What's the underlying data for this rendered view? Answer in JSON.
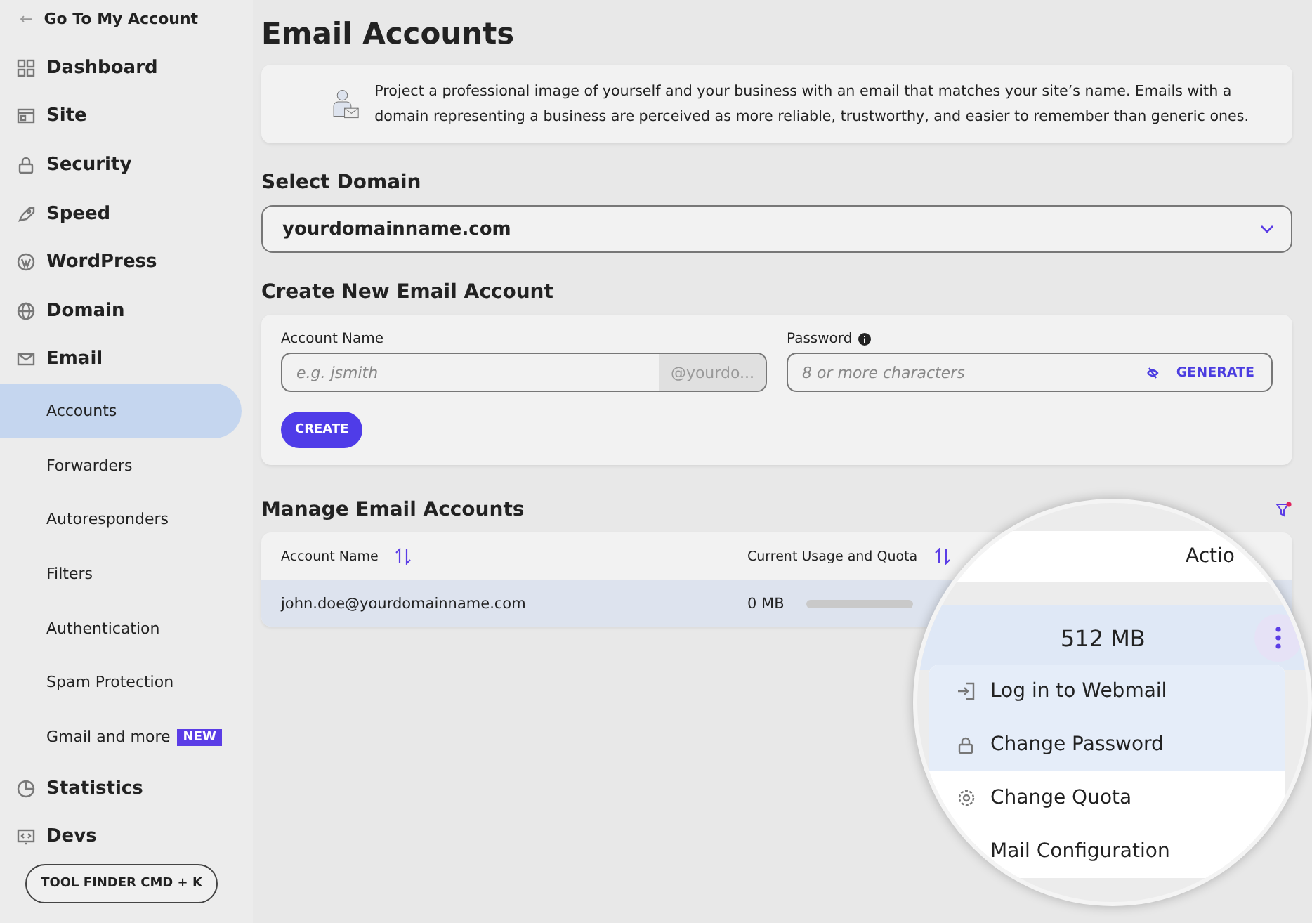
{
  "back_link": {
    "arrow": "←",
    "label": "Go To My Account"
  },
  "sidebar": {
    "items": [
      {
        "kind": "section",
        "label": "Dashboard",
        "selected": false
      },
      {
        "kind": "section",
        "label": "Site",
        "selected": false
      },
      {
        "kind": "section",
        "label": "Security",
        "selected": false
      },
      {
        "kind": "section",
        "label": "Speed",
        "selected": false
      },
      {
        "kind": "section",
        "label": "WordPress",
        "selected": false
      },
      {
        "kind": "section",
        "label": "Domain",
        "selected": false
      },
      {
        "kind": "section",
        "label": "Email",
        "selected": false
      },
      {
        "kind": "sub",
        "label": "Accounts",
        "selected": true
      },
      {
        "kind": "sub",
        "label": "Forwarders",
        "selected": false
      },
      {
        "kind": "sub",
        "label": "Autoresponders",
        "selected": false
      },
      {
        "kind": "sub",
        "label": "Filters",
        "selected": false
      },
      {
        "kind": "sub",
        "label": "Authentication",
        "selected": false
      },
      {
        "kind": "sub",
        "label": "Spam Protection",
        "selected": false
      },
      {
        "kind": "sub",
        "label": "Gmail and more",
        "badge": "NEW",
        "selected": false
      },
      {
        "kind": "section",
        "label": "Statistics",
        "selected": false
      },
      {
        "kind": "section",
        "label": "Devs",
        "selected": false
      }
    ],
    "tool_finder": "TOOL FINDER CMD + K"
  },
  "page_title": "Email Accounts",
  "info_text": "Project a professional image of yourself and your business with an email that matches your site’s name. Emails with a domain representing a business are perceived as more reliable, trustworthy, and easier to remember than generic ones.",
  "select_domain": {
    "heading": "Select Domain",
    "value": "yourdomainname.com"
  },
  "create": {
    "heading": "Create New Email Account",
    "account_label": "Account Name",
    "account_placeholder": "e.g. jsmith",
    "domain_suffix": "@yourdo...",
    "password_label": "Password",
    "password_placeholder": "8 or more characters",
    "generate": "GENERATE",
    "button": "CREATE"
  },
  "manage": {
    "heading": "Manage Email Accounts",
    "columns": [
      "Account Name",
      "Current Usage and Quota"
    ],
    "rows": [
      {
        "account": "john.doe@yourdomainname.com",
        "usage": "0 MB",
        "level": 0
      }
    ]
  },
  "magnifier": {
    "actions_header": "Actio",
    "quota": "512 MB",
    "menu": [
      {
        "label": "Log in to Webmail",
        "highlighted": true
      },
      {
        "label": "Change Password",
        "highlighted": true
      },
      {
        "label": "Change Quota",
        "highlighted": false
      },
      {
        "label": "Mail Configuration",
        "highlighted": false
      }
    ]
  }
}
